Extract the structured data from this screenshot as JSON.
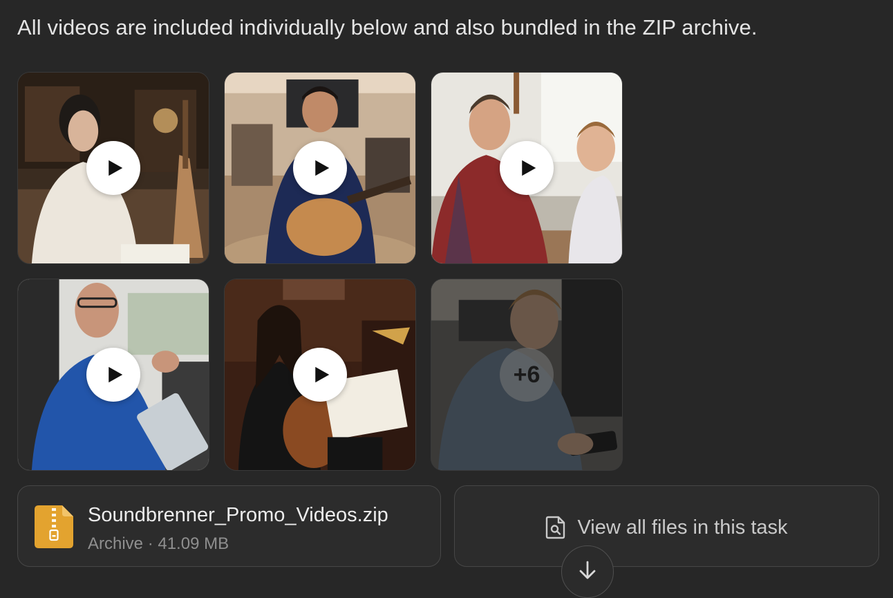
{
  "intro_text": "All videos are included individually below and also bundled in the ZIP archive.",
  "videos": [
    {
      "icon": "play-icon"
    },
    {
      "icon": "play-icon"
    },
    {
      "icon": "play-icon"
    },
    {
      "icon": "play-icon"
    },
    {
      "icon": "play-icon"
    },
    {
      "overlay_label": "+6"
    }
  ],
  "attachment": {
    "icon": "zip-file-icon",
    "icon_color": "#E3A32F",
    "name": "Soundbrenner_Promo_Videos.zip",
    "meta": "Archive · 41.09 MB"
  },
  "view_all": {
    "icon": "file-search-icon",
    "label": "View all files in this task"
  },
  "scroll_button": {
    "icon": "arrow-down-icon"
  }
}
